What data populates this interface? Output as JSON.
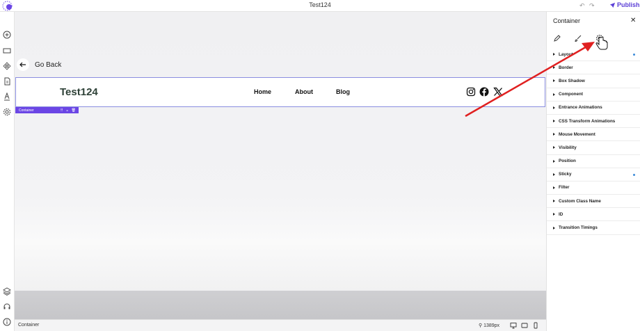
{
  "app": {
    "title": "Test124",
    "publish_label": "Publish",
    "logo_icon": "builder-logo-icon"
  },
  "leftbar": {
    "icons": [
      "add-icon",
      "section-icon",
      "components-icon",
      "pages-icon",
      "typography-icon",
      "settings-icon",
      "layers-icon",
      "support-icon",
      "info-icon"
    ]
  },
  "canvas": {
    "go_back_label": "Go Back",
    "brand": "Test124",
    "nav": [
      "Home",
      "About",
      "Blog"
    ],
    "social_icons": [
      "instagram-icon",
      "facebook-icon",
      "x-icon"
    ],
    "selected_tag": "Container"
  },
  "statusbar": {
    "label": "Container",
    "zoom": "1389px"
  },
  "panel": {
    "title": "Container",
    "tabs": [
      "pencil-icon",
      "brush-icon",
      "gear-icon"
    ],
    "items": [
      {
        "label": "Layout",
        "dot": true
      },
      {
        "label": "Border",
        "dot": false
      },
      {
        "label": "Box Shadow",
        "dot": false
      },
      {
        "label": "Component",
        "dot": false
      },
      {
        "label": "Entrance Animations",
        "dot": false
      },
      {
        "label": "CSS Transform Animations",
        "dot": false
      },
      {
        "label": "Mouse Movement",
        "dot": false
      },
      {
        "label": "Visibility",
        "dot": false
      },
      {
        "label": "Position",
        "dot": false
      },
      {
        "label": "Sticky",
        "dot": true
      },
      {
        "label": "Filter",
        "dot": false
      },
      {
        "label": "Custom Class Name",
        "dot": false
      },
      {
        "label": "ID",
        "dot": false
      },
      {
        "label": "Transition Timings",
        "dot": false
      }
    ]
  },
  "colors": {
    "accent": "#6b46e5",
    "dot": "#3d8bd9",
    "arrow": "#e02020"
  }
}
